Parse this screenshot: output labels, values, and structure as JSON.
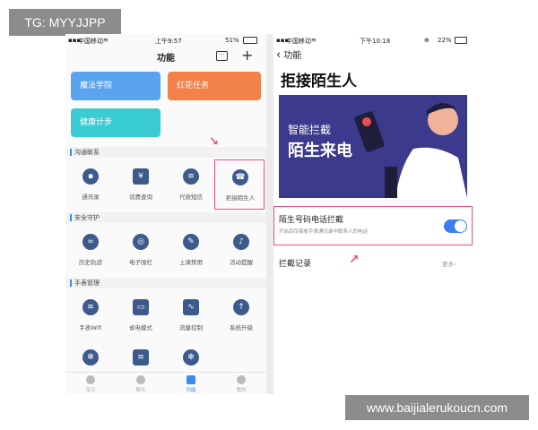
{
  "watermark_top": "TG: MYYJJPP",
  "watermark_bottom": "www.baijialerukoucn.com",
  "left": {
    "status": {
      "carrier": "中国移动",
      "time": "上午9:57",
      "battery": "51%"
    },
    "nav": {
      "title": "功能"
    },
    "cards": [
      {
        "label": "魔法学院",
        "color": "#5aa3ef"
      },
      {
        "label": "红花任务",
        "color": "#f2814a"
      },
      {
        "label": "健康计步",
        "color": "#39cdd3"
      }
    ],
    "sections": [
      {
        "title": "沟通联系",
        "items": [
          "通讯录",
          "话费查询",
          "代收短信",
          "拒接陌生人"
        ]
      },
      {
        "title": "安全守护",
        "items": [
          "历史轨迹",
          "电子围栏",
          "上课禁用",
          "活动提醒"
        ]
      },
      {
        "title": "手表管理",
        "items": [
          "手表Wifi",
          "省电模式",
          "流量控制",
          "系统升级"
        ]
      }
    ],
    "tabs": [
      "宝贝",
      "聊天",
      "功能",
      "我的"
    ],
    "accent": "#e94f8b"
  },
  "right": {
    "status": {
      "carrier": "中国移动",
      "time": "下午10:18",
      "battery": "22%"
    },
    "nav": {
      "back": "功能"
    },
    "title": "拒接陌生人",
    "banner": {
      "line1": "智能拦截",
      "line2": "陌生来电"
    },
    "setting": {
      "title": "陌生号码电话拦截",
      "desc": "开启后仅接收手表通讯录中联系人的电话",
      "enabled": true
    },
    "record": {
      "label": "拦截记录",
      "more": "更多"
    }
  }
}
